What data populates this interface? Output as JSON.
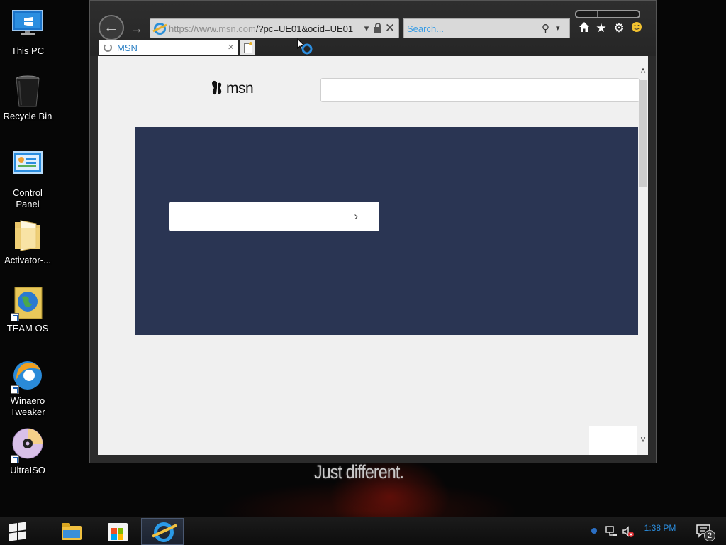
{
  "desktop": {
    "icons": [
      {
        "label": "This PC"
      },
      {
        "label": "Recycle Bin"
      },
      {
        "label": "Control Panel"
      },
      {
        "label": "Activator-..."
      },
      {
        "label": "TEAM OS"
      },
      {
        "label": "Winaero Tweaker"
      },
      {
        "label": "UltraISO"
      }
    ],
    "wallpaper_text": "Just different."
  },
  "browser": {
    "address": {
      "url_prefix": "https://www.",
      "url_domain": "msn.com",
      "url_rest": "/?pc=UE01&ocid=UE01"
    },
    "search": {
      "placeholder": "Search..."
    },
    "tab": {
      "title": "MSN"
    },
    "page": {
      "logo_text": "msn",
      "search_value": "",
      "hero_button_chevron": "›"
    },
    "icons": {
      "back": "back-arrow-icon",
      "forward": "forward-arrow-icon",
      "home": "home-icon",
      "favorites": "star-icon",
      "tools": "gear-icon",
      "feedback": "smiley-icon"
    }
  },
  "taskbar": {
    "apps": [
      "File Explorer",
      "Microsoft Store",
      "Internet Explorer"
    ],
    "clock": "1:38 PM",
    "notification_count": "2"
  },
  "colors": {
    "hero_bg": "#2a3553",
    "accent_blue": "#2b8ee0"
  }
}
